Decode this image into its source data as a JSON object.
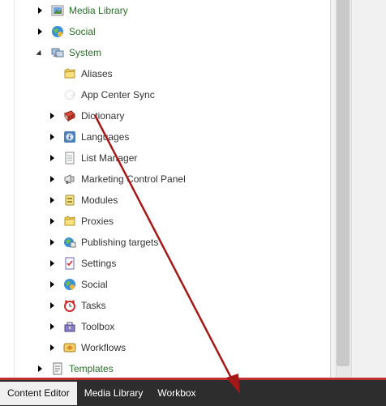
{
  "tree": {
    "top_items": [
      {
        "label": "Media Library",
        "icon": "media-library-icon",
        "expanded": false
      },
      {
        "label": "Social",
        "icon": "social-globe-icon",
        "expanded": false
      },
      {
        "label": "System",
        "icon": "system-icon",
        "expanded": true
      }
    ],
    "system_children": [
      {
        "label": "Aliases",
        "icon": "folder-icon",
        "has_children": false
      },
      {
        "label": "App Center Sync",
        "icon": "sync-icon",
        "has_children": false
      },
      {
        "label": "Dictionary",
        "icon": "book-icon",
        "has_children": true
      },
      {
        "label": "Languages",
        "icon": "languages-icon",
        "has_children": true
      },
      {
        "label": "List Manager",
        "icon": "list-icon",
        "has_children": true
      },
      {
        "label": "Marketing Control Panel",
        "icon": "marketing-icon",
        "has_children": true
      },
      {
        "label": "Modules",
        "icon": "modules-icon",
        "has_children": true
      },
      {
        "label": "Proxies",
        "icon": "folder-icon",
        "has_children": true
      },
      {
        "label": "Publishing targets",
        "icon": "publishing-icon",
        "has_children": true
      },
      {
        "label": "Settings",
        "icon": "settings-icon",
        "has_children": true
      },
      {
        "label": "Social",
        "icon": "social-globe-icon",
        "has_children": true
      },
      {
        "label": "Tasks",
        "icon": "clock-icon",
        "has_children": true
      },
      {
        "label": "Toolbox",
        "icon": "toolbox-icon",
        "has_children": true
      },
      {
        "label": "Workflows",
        "icon": "workflow-icon",
        "has_children": true
      }
    ],
    "bottom_items": [
      {
        "label": "Templates",
        "icon": "templates-icon",
        "expanded": false
      }
    ]
  },
  "footer": {
    "tabs": [
      {
        "label": "Content Editor",
        "active": true
      },
      {
        "label": "Media Library",
        "active": false
      },
      {
        "label": "Workbox",
        "active": false
      }
    ]
  },
  "colors": {
    "accent_red": "#c22d2d",
    "footer_bg": "#2d2d2d",
    "arrow": "#b01e1e"
  }
}
